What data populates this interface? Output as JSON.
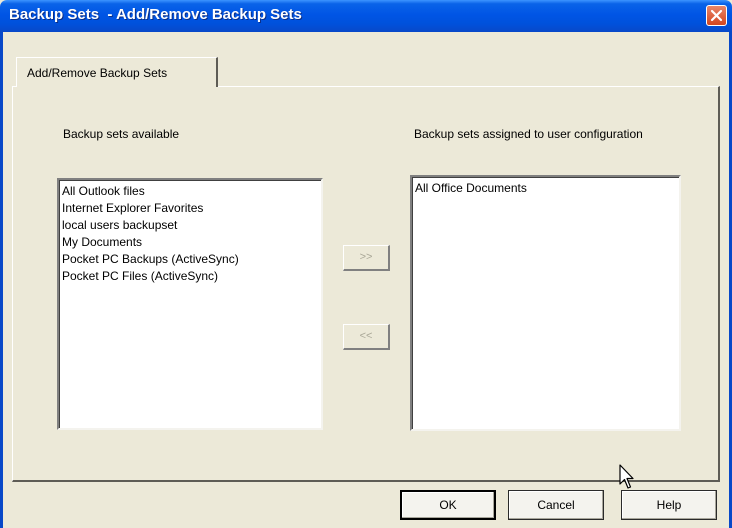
{
  "window": {
    "title": "Backup Sets  - Add/Remove Backup Sets"
  },
  "tab": {
    "label": "Add/Remove Backup Sets"
  },
  "available": {
    "heading": "Backup sets available",
    "items": [
      "All Outlook files",
      "Internet Explorer Favorites",
      "local users backupset",
      "My Documents",
      "Pocket PC Backups (ActiveSync)",
      "Pocket PC Files (ActiveSync)"
    ]
  },
  "assigned": {
    "heading": "Backup sets assigned to user configuration",
    "items": [
      "All Office Documents"
    ]
  },
  "transfer": {
    "add_label": ">>",
    "remove_label": "<<"
  },
  "buttons": {
    "ok": "OK",
    "cancel": "Cancel",
    "help": "Help"
  },
  "icons": {
    "close": "close-icon",
    "cursor": "mouse-pointer-icon"
  }
}
